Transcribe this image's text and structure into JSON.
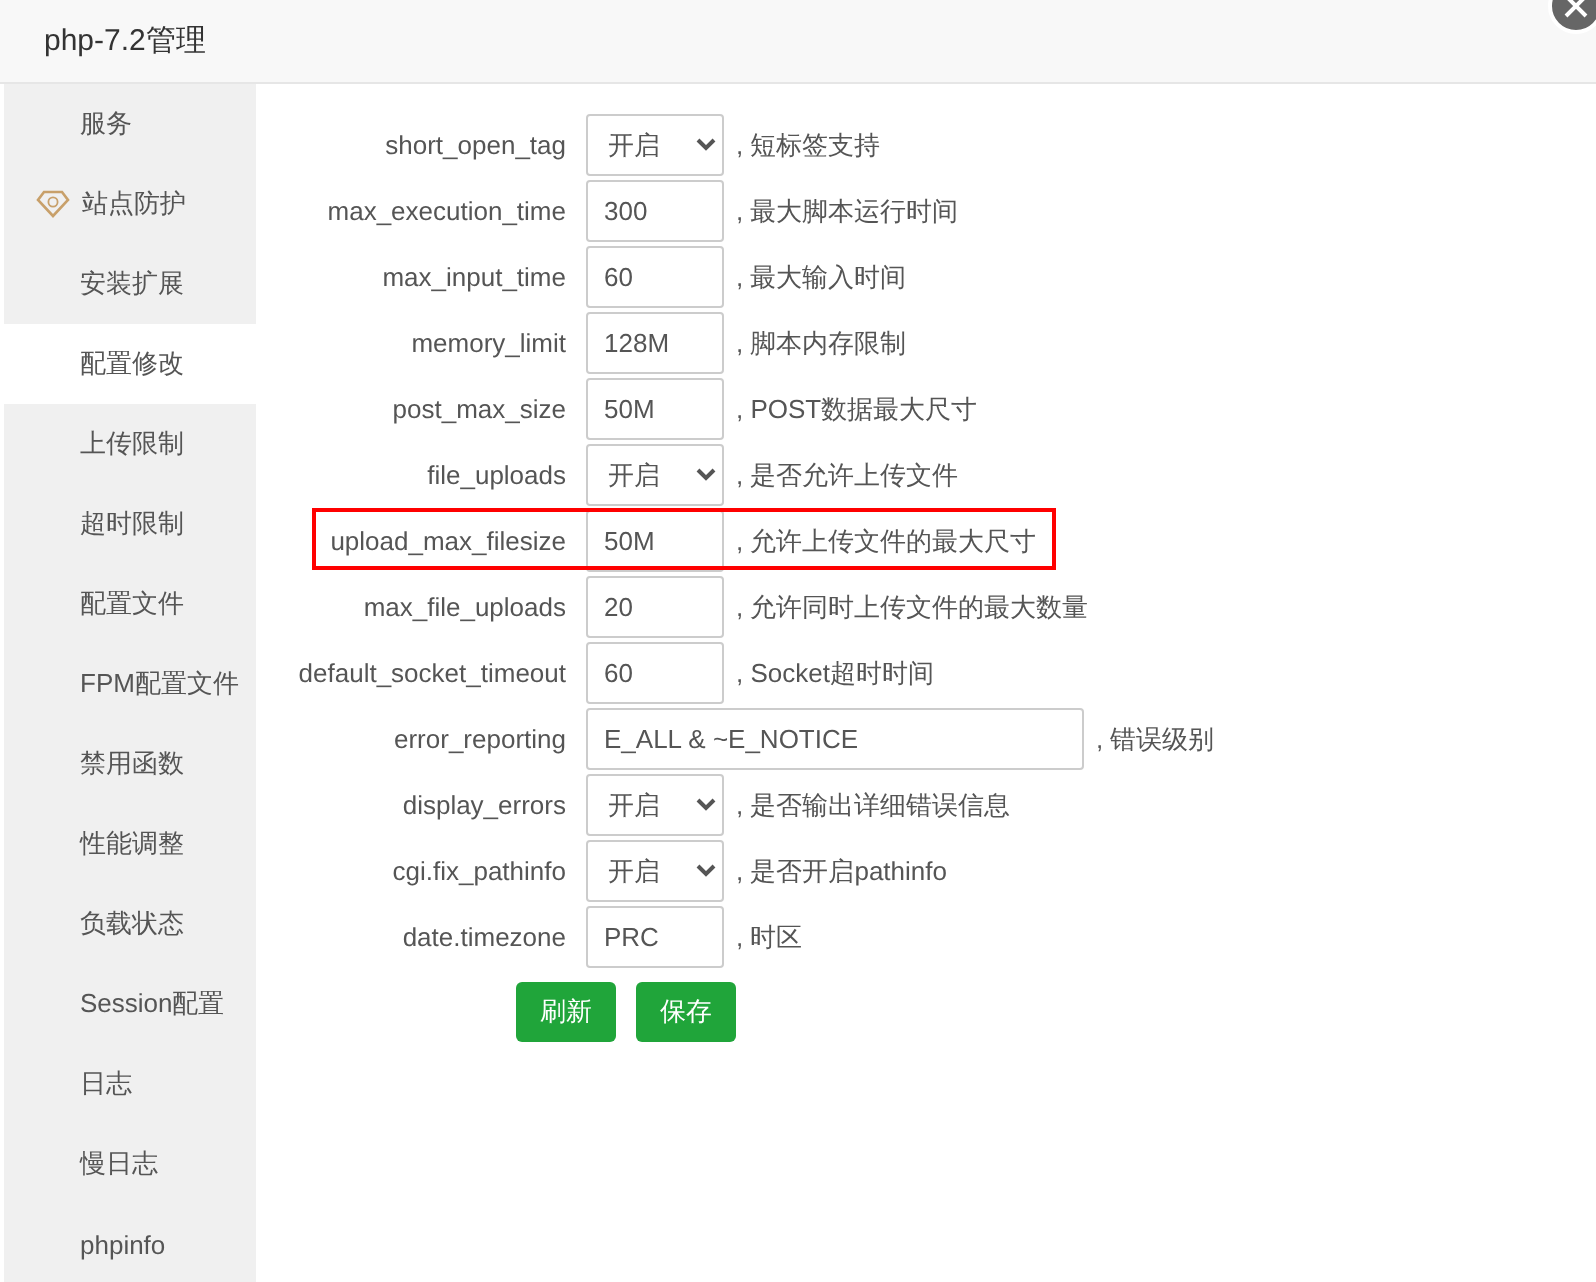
{
  "window": {
    "title": "php-7.2管理"
  },
  "sidebar": {
    "items": [
      {
        "label": "服务",
        "selected": false
      },
      {
        "label": "站点防护",
        "selected": false,
        "kind": "icon"
      },
      {
        "label": "安装扩展",
        "selected": false
      },
      {
        "label": "配置修改",
        "selected": true
      },
      {
        "label": "上传限制",
        "selected": false
      },
      {
        "label": "超时限制",
        "selected": false
      },
      {
        "label": "配置文件",
        "selected": false
      },
      {
        "label": "FPM配置文件",
        "selected": false
      },
      {
        "label": "禁用函数",
        "selected": false
      },
      {
        "label": "性能调整",
        "selected": false
      },
      {
        "label": "负载状态",
        "selected": false
      },
      {
        "label": "Session配置",
        "selected": false
      },
      {
        "label": "日志",
        "selected": false
      },
      {
        "label": "慢日志",
        "selected": false
      },
      {
        "label": "phpinfo",
        "selected": false
      }
    ]
  },
  "settings": [
    {
      "name": "short_open_tag",
      "kind": "select",
      "value": "开启",
      "note": ", 短标签支持",
      "highlighted": false
    },
    {
      "name": "max_execution_time",
      "kind": "input",
      "value": "300",
      "note": ", 最大脚本运行时间",
      "highlighted": false
    },
    {
      "name": "max_input_time",
      "kind": "input",
      "value": "60",
      "note": ", 最大输入时间",
      "highlighted": false
    },
    {
      "name": "memory_limit",
      "kind": "input",
      "value": "128M",
      "note": ", 脚本内存限制",
      "highlighted": false
    },
    {
      "name": "post_max_size",
      "kind": "input",
      "value": "50M",
      "note": ", POST数据最大尺寸",
      "highlighted": false
    },
    {
      "name": "file_uploads",
      "kind": "select",
      "value": "开启",
      "note": ", 是否允许上传文件",
      "highlighted": false
    },
    {
      "name": "upload_max_filesize",
      "kind": "input",
      "value": "50M",
      "note": ", 允许上传文件的最大尺寸",
      "highlighted": true
    },
    {
      "name": "max_file_uploads",
      "kind": "input",
      "value": "20",
      "note": ", 允许同时上传文件的最大数量",
      "highlighted": false
    },
    {
      "name": "default_socket_timeout",
      "kind": "input",
      "value": "60",
      "note": ", Socket超时时间",
      "highlighted": false
    },
    {
      "name": "error_reporting",
      "kind": "wide",
      "value": "E_ALL & ~E_NOTICE",
      "note": ", 错误级别",
      "highlighted": false
    },
    {
      "name": "display_errors",
      "kind": "select",
      "value": "开启",
      "note": ", 是否输出详细错误信息",
      "highlighted": false
    },
    {
      "name": "cgi.fix_pathinfo",
      "kind": "select",
      "value": "开启",
      "note": ", 是否开启pathinfo",
      "highlighted": false
    },
    {
      "name": "date.timezone",
      "kind": "input",
      "value": "PRC",
      "note": ", 时区",
      "highlighted": false
    }
  ],
  "buttons": [
    "刷新",
    "保存"
  ]
}
